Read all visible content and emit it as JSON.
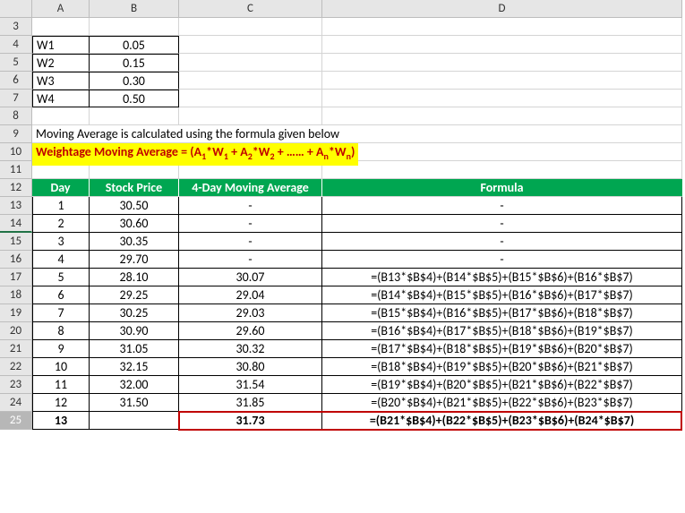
{
  "columns": [
    "A",
    "B",
    "C",
    "D"
  ],
  "weights": {
    "w1": {
      "label": "W1",
      "value": "0.05"
    },
    "w2": {
      "label": "W2",
      "value": "0.15"
    },
    "w3": {
      "label": "W3",
      "value": "0.30"
    },
    "w4": {
      "label": "W4",
      "value": "0.50"
    }
  },
  "desc": "Moving Average is calculated using the formula given below",
  "formula_label_prefix": "Weightage Moving Average = (A",
  "formula_label_full": "Weightage Moving Average = (A₁*W₁ + A₂*W₂ + …… + Aₙ*Wₙ)",
  "headers": {
    "day": "Day",
    "price": "Stock Price",
    "avg": "4-Day Moving Average",
    "formula": "Formula"
  },
  "rows": [
    {
      "n": "1",
      "price": "30.50",
      "avg": "-",
      "formula": "-"
    },
    {
      "n": "2",
      "price": "30.60",
      "avg": "-",
      "formula": "-"
    },
    {
      "n": "3",
      "price": "30.35",
      "avg": "-",
      "formula": "-"
    },
    {
      "n": "4",
      "price": "29.70",
      "avg": "-",
      "formula": "-"
    },
    {
      "n": "5",
      "price": "28.10",
      "avg": "30.07",
      "formula": "=(B13*$B$4)+(B14*$B$5)+(B15*$B$6)+(B16*$B$7)"
    },
    {
      "n": "6",
      "price": "29.25",
      "avg": "29.04",
      "formula": "=(B14*$B$4)+(B15*$B$5)+(B16*$B$6)+(B17*$B$7)"
    },
    {
      "n": "7",
      "price": "30.25",
      "avg": "29.03",
      "formula": "=(B15*$B$4)+(B16*$B$5)+(B17*$B$6)+(B18*$B$7)"
    },
    {
      "n": "8",
      "price": "30.90",
      "avg": "29.60",
      "formula": "=(B16*$B$4)+(B17*$B$5)+(B18*$B$6)+(B19*$B$7)"
    },
    {
      "n": "9",
      "price": "31.05",
      "avg": "30.32",
      "formula": "=(B17*$B$4)+(B18*$B$5)+(B19*$B$6)+(B20*$B$7)"
    },
    {
      "n": "10",
      "price": "32.15",
      "avg": "30.80",
      "formula": "=(B18*$B$4)+(B19*$B$5)+(B20*$B$6)+(B21*$B$7)"
    },
    {
      "n": "11",
      "price": "32.00",
      "avg": "31.54",
      "formula": "=(B19*$B$4)+(B20*$B$5)+(B21*$B$6)+(B22*$B$7)"
    },
    {
      "n": "12",
      "price": "31.50",
      "avg": "31.85",
      "formula": "=(B20*$B$4)+(B21*$B$5)+(B22*$B$6)+(B23*$B$7)"
    }
  ],
  "result_row": {
    "n": "13",
    "price": "",
    "avg": "31.73",
    "formula": "=(B21*$B$4)+(B22*$B$5)+(B23*$B$6)+(B24*$B$7)"
  },
  "row_numbers": [
    "3",
    "4",
    "5",
    "6",
    "7",
    "8",
    "9",
    "10",
    "11",
    "12",
    "13",
    "14",
    "15",
    "16",
    "17",
    "18",
    "19",
    "20",
    "21",
    "22",
    "23",
    "24",
    "25"
  ]
}
